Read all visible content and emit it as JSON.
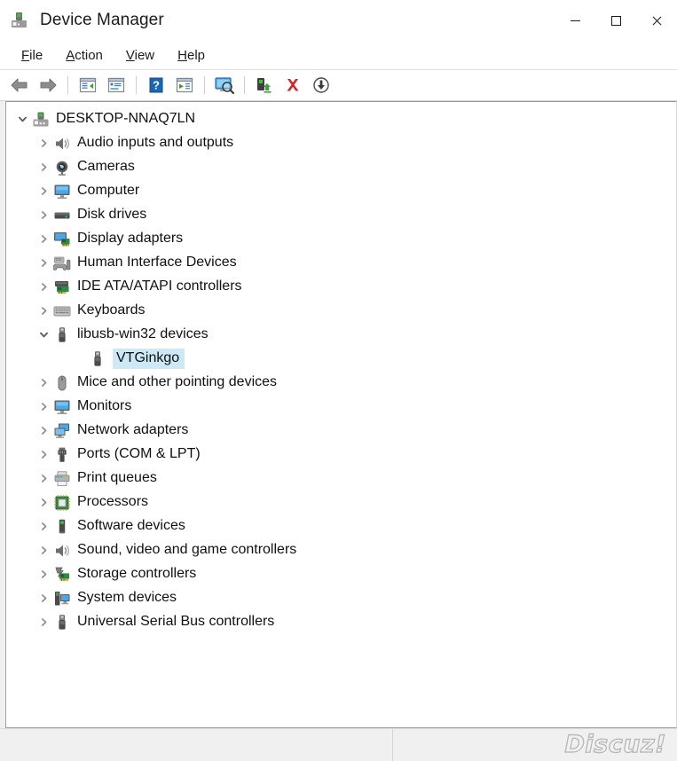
{
  "window": {
    "title": "Device Manager",
    "app_icon": "device-manager-icon",
    "controls": {
      "minimize": "minimize-button",
      "maximize": "maximize-button",
      "close": "close-button"
    }
  },
  "menubar": {
    "items": [
      {
        "label": "File",
        "accel": "F"
      },
      {
        "label": "Action",
        "accel": "A"
      },
      {
        "label": "View",
        "accel": "V"
      },
      {
        "label": "Help",
        "accel": "H"
      }
    ]
  },
  "toolbar": {
    "buttons": [
      {
        "name": "back-button",
        "icon": "back-arrow-icon"
      },
      {
        "name": "forward-button",
        "icon": "forward-arrow-icon"
      },
      {
        "name": "show-hide-console-tree-button",
        "icon": "console-tree-icon"
      },
      {
        "name": "properties-button",
        "icon": "properties-icon"
      },
      {
        "name": "help-button",
        "icon": "help-question-icon"
      },
      {
        "name": "update-driver-button",
        "icon": "update-driver-icon"
      },
      {
        "name": "scan-hardware-changes-button",
        "icon": "scan-monitor-icon"
      },
      {
        "name": "enable-device-button",
        "icon": "enable-device-icon"
      },
      {
        "name": "uninstall-device-button",
        "icon": "red-x-icon"
      },
      {
        "name": "download-button",
        "icon": "download-circle-icon"
      }
    ]
  },
  "tree": {
    "nodes": [
      {
        "label": "DESKTOP-NNAQ7LN",
        "level": 0,
        "state": "expanded",
        "icon": "computer-root-icon",
        "selected": false
      },
      {
        "label": "Audio inputs and outputs",
        "level": 1,
        "state": "collapsed",
        "icon": "speaker-icon",
        "selected": false
      },
      {
        "label": "Cameras",
        "level": 1,
        "state": "collapsed",
        "icon": "camera-icon",
        "selected": false
      },
      {
        "label": "Computer",
        "level": 1,
        "state": "collapsed",
        "icon": "monitor-icon",
        "selected": false
      },
      {
        "label": "Disk drives",
        "level": 1,
        "state": "collapsed",
        "icon": "disk-drive-icon",
        "selected": false
      },
      {
        "label": "Display adapters",
        "level": 1,
        "state": "collapsed",
        "icon": "display-adapter-icon",
        "selected": false
      },
      {
        "label": "Human Interface Devices",
        "level": 1,
        "state": "collapsed",
        "icon": "hid-gamepad-icon",
        "selected": false
      },
      {
        "label": "IDE ATA/ATAPI controllers",
        "level": 1,
        "state": "collapsed",
        "icon": "ide-controller-icon",
        "selected": false
      },
      {
        "label": "Keyboards",
        "level": 1,
        "state": "collapsed",
        "icon": "keyboard-icon",
        "selected": false
      },
      {
        "label": "libusb-win32 devices",
        "level": 1,
        "state": "expanded",
        "icon": "usb-device-icon",
        "selected": false
      },
      {
        "label": "VTGinkgo",
        "level": 2,
        "state": "leaf",
        "icon": "usb-device-icon",
        "selected": true
      },
      {
        "label": "Mice and other pointing devices",
        "level": 1,
        "state": "collapsed",
        "icon": "mouse-icon",
        "selected": false
      },
      {
        "label": "Monitors",
        "level": 1,
        "state": "collapsed",
        "icon": "monitor-icon",
        "selected": false
      },
      {
        "label": "Network adapters",
        "level": 1,
        "state": "collapsed",
        "icon": "network-adapter-icon",
        "selected": false
      },
      {
        "label": "Ports (COM & LPT)",
        "level": 1,
        "state": "collapsed",
        "icon": "port-connector-icon",
        "selected": false
      },
      {
        "label": "Print queues",
        "level": 1,
        "state": "collapsed",
        "icon": "printer-icon",
        "selected": false
      },
      {
        "label": "Processors",
        "level": 1,
        "state": "collapsed",
        "icon": "processor-chip-icon",
        "selected": false
      },
      {
        "label": "Software devices",
        "level": 1,
        "state": "collapsed",
        "icon": "software-device-icon",
        "selected": false
      },
      {
        "label": "Sound, video and game controllers",
        "level": 1,
        "state": "collapsed",
        "icon": "speaker-icon",
        "selected": false
      },
      {
        "label": "Storage controllers",
        "level": 1,
        "state": "collapsed",
        "icon": "storage-controller-icon",
        "selected": false
      },
      {
        "label": "System devices",
        "level": 1,
        "state": "collapsed",
        "icon": "system-device-icon",
        "selected": false
      },
      {
        "label": "Universal Serial Bus controllers",
        "level": 1,
        "state": "collapsed",
        "icon": "usb-device-icon",
        "selected": false
      }
    ]
  },
  "statusbar": {
    "left_text": "",
    "right_text": "",
    "watermark": "Discuz!"
  },
  "colors": {
    "selection": "#cde8f6",
    "accent_blue": "#2a7fd4",
    "red": "#d6242a",
    "green": "#3aa537",
    "window_bg": "#ffffff",
    "chrome_bg": "#f0f0f0"
  }
}
